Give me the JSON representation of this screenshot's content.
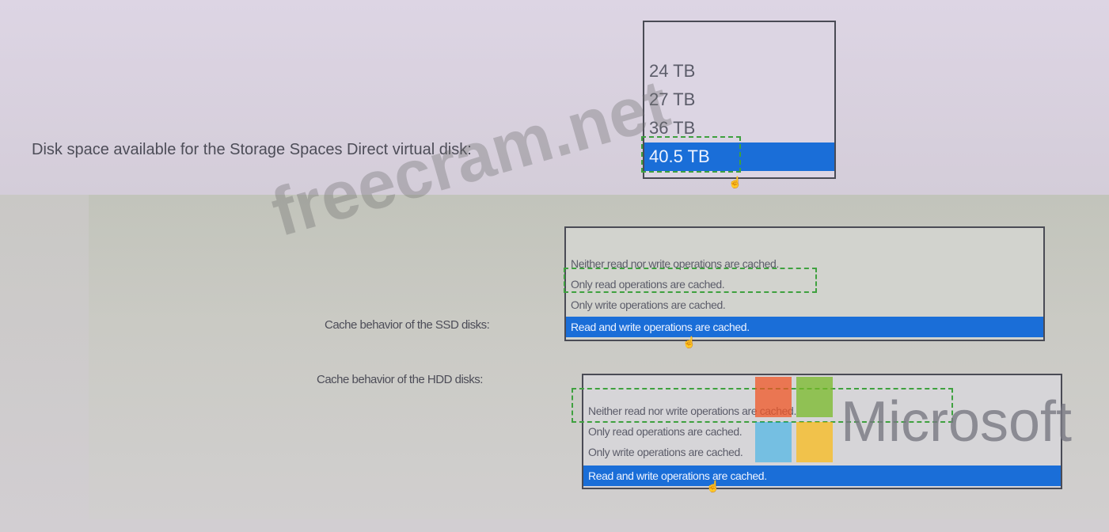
{
  "question1": {
    "label": "Disk space available for the Storage Spaces Direct virtual disk:",
    "options": [
      "24 TB",
      "27 TB",
      "36 TB",
      "40.5 TB"
    ],
    "selected_index": 3
  },
  "question2": {
    "label": "Cache behavior of the SSD disks:",
    "options": [
      "Neither read nor write operations are cached.",
      "Only read operations are cached.",
      "Only write operations are cached.",
      "Read and write operations are cached."
    ],
    "selected_index": 3
  },
  "question3": {
    "label": "Cache behavior of the HDD disks:",
    "options": [
      "Neither read nor write operations are cached.",
      "Only read operations are cached.",
      "Only write operations are cached.",
      "Read and write operations are cached."
    ],
    "selected_index": 3
  },
  "watermark": {
    "site": "freecram.net",
    "brand": "Microsoft"
  },
  "colors": {
    "selected_bg": "#1a6ed8",
    "answer_marker": "#3fa13f"
  }
}
